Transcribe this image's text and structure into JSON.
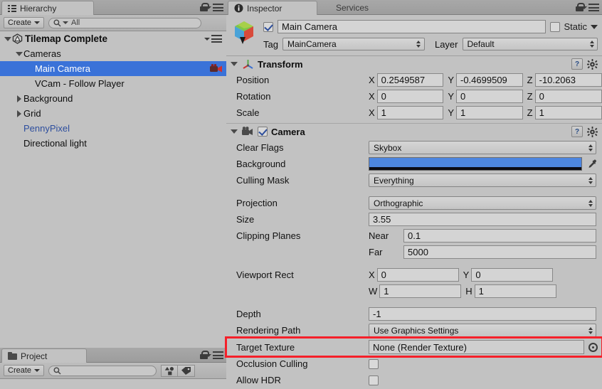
{
  "hierarchy": {
    "tab_label": "Hierarchy",
    "tab_icon": "hierarchy-icon",
    "create_label": "Create",
    "search_placeholder": "All",
    "search_value": "All",
    "search_icon": "search-icon",
    "lock_icon": "lock-icon",
    "menu_icon": "hamburger-menu-icon",
    "items": [
      {
        "label": "Tilemap Complete",
        "depth": 0,
        "twisty": "down",
        "icon": "unity-scene-icon",
        "selected": false,
        "style": "root"
      },
      {
        "label": "Cameras",
        "depth": 1,
        "twisty": "down",
        "icon": "",
        "selected": false,
        "style": "normal"
      },
      {
        "label": "Main Camera",
        "depth": 2,
        "twisty": "none",
        "icon": "",
        "selected": true,
        "style": "normal"
      },
      {
        "label": "VCam - Follow Player",
        "depth": 2,
        "twisty": "none",
        "icon": "",
        "selected": false,
        "style": "normal"
      },
      {
        "label": "Background",
        "depth": 1,
        "twisty": "right",
        "icon": "",
        "selected": false,
        "style": "normal"
      },
      {
        "label": "Grid",
        "depth": 1,
        "twisty": "right",
        "icon": "",
        "selected": false,
        "style": "normal"
      },
      {
        "label": "PennyPixel",
        "depth": 1,
        "twisty": "none",
        "icon": "",
        "selected": false,
        "style": "prefab"
      },
      {
        "label": "Directional light",
        "depth": 1,
        "twisty": "none",
        "icon": "",
        "selected": false,
        "style": "normal"
      }
    ]
  },
  "project": {
    "tab_label": "Project",
    "tab_icon": "folder-icon",
    "create_label": "Create",
    "search_placeholder": "",
    "search_value": "",
    "lock_icon": "lock-icon",
    "menu_icon": "hamburger-menu-icon",
    "filter_type_icon": "shapes-filter-icon",
    "filter_label_icon": "tag-filter-icon"
  },
  "inspector": {
    "tabs": [
      {
        "label": "Inspector",
        "icon": "info-icon",
        "active": true
      },
      {
        "label": "Services",
        "icon": "",
        "active": false
      }
    ],
    "lock_icon": "lock-icon",
    "menu_icon": "hamburger-menu-icon",
    "object_header": {
      "icon": "prefab-cube-icon",
      "enabled": true,
      "name": "Main Camera",
      "static_label": "Static",
      "static_checked": false,
      "tag_label": "Tag",
      "tag_value": "MainCamera",
      "layer_label": "Layer",
      "layer_value": "Default"
    },
    "components": [
      {
        "name": "Transform",
        "icon": "transform-axis-icon",
        "expanded": true,
        "has_checkbox": false,
        "help_icon": "help-book-icon",
        "gear_icon": "gear-icon",
        "rows": [
          {
            "type": "vector3",
            "label": "Position",
            "axes": [
              "X",
              "Y",
              "Z"
            ],
            "values": [
              "0.2549587",
              "-0.4699509",
              "-10.2063"
            ]
          },
          {
            "type": "vector3",
            "label": "Rotation",
            "axes": [
              "X",
              "Y",
              "Z"
            ],
            "values": [
              "0",
              "0",
              "0"
            ]
          },
          {
            "type": "vector3",
            "label": "Scale",
            "axes": [
              "X",
              "Y",
              "Z"
            ],
            "values": [
              "1",
              "1",
              "1"
            ]
          }
        ]
      },
      {
        "name": "Camera",
        "icon": "camera-icon",
        "expanded": true,
        "has_checkbox": true,
        "checked": true,
        "help_icon": "help-book-icon",
        "gear_icon": "gear-icon",
        "rows": [
          {
            "type": "dropdown",
            "label": "Clear Flags",
            "value": "Skybox"
          },
          {
            "type": "color",
            "label": "Background",
            "value": "#4d86e0",
            "alpha_color": "#0b0b14",
            "eyedropper_icon": "eyedropper-icon"
          },
          {
            "type": "dropdown",
            "label": "Culling Mask",
            "value": "Everything"
          },
          {
            "type": "spacer"
          },
          {
            "type": "dropdown",
            "label": "Projection",
            "value": "Orthographic"
          },
          {
            "type": "text",
            "label": "Size",
            "value": "3.55"
          },
          {
            "type": "pair",
            "label": "Clipping Planes",
            "sub_label": "Near",
            "value": "0.1"
          },
          {
            "type": "pair",
            "label": "",
            "sub_label": "Far",
            "value": "5000"
          },
          {
            "type": "spacer"
          },
          {
            "type": "vector2",
            "label": "Viewport Rect",
            "axes": [
              "X",
              "Y"
            ],
            "values": [
              "0",
              "0"
            ]
          },
          {
            "type": "vector2",
            "label": "",
            "axes": [
              "W",
              "H"
            ],
            "values": [
              "1",
              "1"
            ]
          },
          {
            "type": "spacer"
          },
          {
            "type": "text",
            "label": "Depth",
            "value": "-1"
          },
          {
            "type": "dropdown",
            "label": "Rendering Path",
            "value": "Use Graphics Settings"
          },
          {
            "type": "object",
            "label": "Target Texture",
            "value": "None (Render Texture)",
            "select_icon": "object-select-icon",
            "highlighted": true
          },
          {
            "type": "checkbox",
            "label": "Occlusion Culling",
            "checked": false
          },
          {
            "type": "checkbox",
            "label": "Allow HDR",
            "checked": false
          }
        ]
      }
    ]
  },
  "annotation": {
    "highlight_color": "#f5202a",
    "target_row": "Target Texture"
  }
}
